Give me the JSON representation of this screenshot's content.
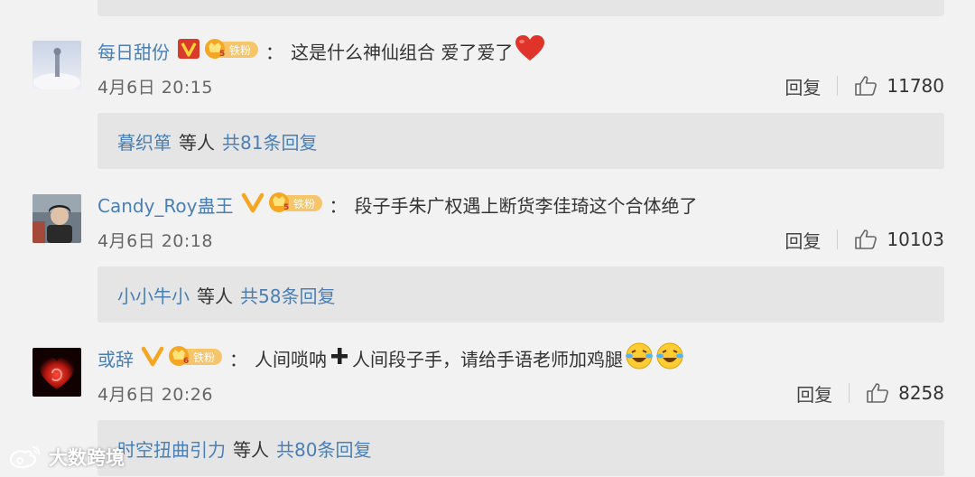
{
  "comments": [
    {
      "username": "每日甜份",
      "verified_icon": "red-vip-v-icon",
      "badge_level": "5",
      "badge_label": "铁粉",
      "colon": "：",
      "text": "这是什么神仙组合 爱了爱了",
      "trailing_icon": "red-heart-emoji-icon",
      "time": "4月6日 20:15",
      "reply_label": "回复",
      "likes": "11780",
      "reply_preview": {
        "user": "暮织箪",
        "mid": "等人",
        "total": "共81条回复"
      }
    },
    {
      "username": "Candy_Roy蛊王",
      "verified_icon": "orange-vip-v-icon",
      "badge_level": "5",
      "badge_label": "铁粉",
      "colon": "：",
      "text": "段子手朱广权遇上断货李佳琦这个合体绝了",
      "time": "4月6日 20:18",
      "reply_label": "回复",
      "likes": "10103",
      "reply_preview": {
        "user": "小小牛小",
        "mid": "等人",
        "total": "共58条回复"
      }
    },
    {
      "username": "或辞",
      "verified_icon": "orange-vip-v-icon",
      "badge_level": "6",
      "badge_label": "铁粉",
      "colon": "：",
      "text_a": "人间唢呐",
      "plus_icon": "heavy-plus-icon",
      "text_b": "人间段子手，请给手语老师加鸡腿",
      "trailing_icon": "laugh-cry-emoji-icon",
      "time": "4月6日 20:26",
      "reply_label": "回复",
      "likes": "8258",
      "reply_preview": {
        "user": "时空扭曲引力",
        "mid": "等人",
        "total": "共80条回复"
      }
    }
  ],
  "watermark": {
    "text": "大数跨境",
    "icon": "weibo-logo-icon"
  },
  "colors": {
    "link": "#4a7fb5",
    "background": "#f2f2f2",
    "reply_box": "#e5e5e5",
    "badge_gold": "#f5a623"
  }
}
